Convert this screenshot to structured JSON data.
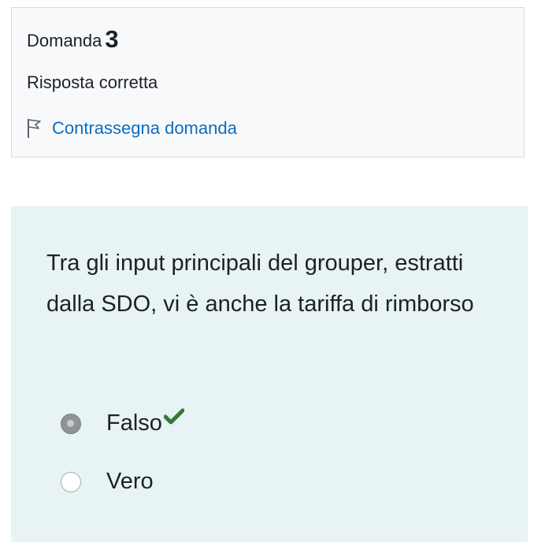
{
  "info": {
    "question_label": "Domanda",
    "question_number": "3",
    "state": "Risposta corretta",
    "flag_label": "Contrassegna domanda",
    "flag_icon": "flag-icon"
  },
  "question": {
    "text": "Tra gli input principali del grouper, estratti dalla SDO, vi è anche la tariffa di rimborso",
    "answers": [
      {
        "label": "Falso",
        "selected": true,
        "correct_mark": "check-icon"
      },
      {
        "label": "Vero",
        "selected": false
      }
    ]
  },
  "colors": {
    "content_background": "#e7f3f5",
    "link": "#0f6cbf",
    "correct": "#357a32"
  }
}
